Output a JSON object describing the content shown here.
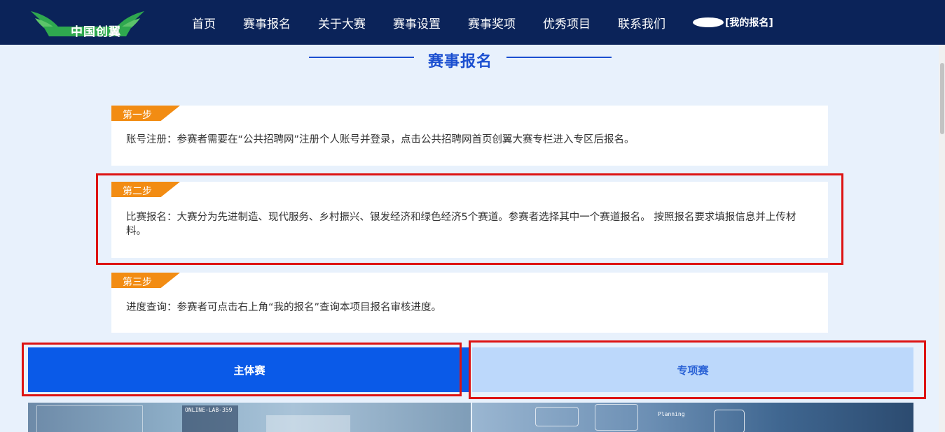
{
  "header": {
    "logo_text": "中国创翼",
    "nav": [
      "首页",
      "赛事报名",
      "关于大赛",
      "赛事设置",
      "赛事奖项",
      "优秀项目",
      "联系我们"
    ],
    "my_registration": "[我的报名]"
  },
  "section": {
    "title": "赛事报名"
  },
  "steps": [
    {
      "tag": "第一步",
      "text": "账号注册：参赛者需要在“公共招聘网”注册个人账号并登录，点击公共招聘网首页创翼大赛专栏进入专区后报名。"
    },
    {
      "tag": "第二步",
      "text": "比赛报名：大赛分为先进制造、现代服务、乡村振兴、银发经济和绿色经济5个赛道。参赛者选择其中一个赛道报名。 按照报名要求填报信息并上传材料。"
    },
    {
      "tag": "第三步",
      "text": "进度查询：参赛者可点击右上角“我的报名”查询本项目报名审核进度。"
    }
  ],
  "tabs": {
    "main": "主体赛",
    "special": "专项赛"
  },
  "image_labels": {
    "left": "ONLINE-LAB-359",
    "right": "Planning"
  },
  "colors": {
    "nav_bg": "#0b2359",
    "accent_blue": "#1b4fd0",
    "step_tag": "#f28c13",
    "tab_active": "#0a5ae8",
    "tab_inactive": "#bcd8fb",
    "highlight": "#dd1313"
  },
  "icons": {
    "logo": "wings-logo-icon"
  }
}
